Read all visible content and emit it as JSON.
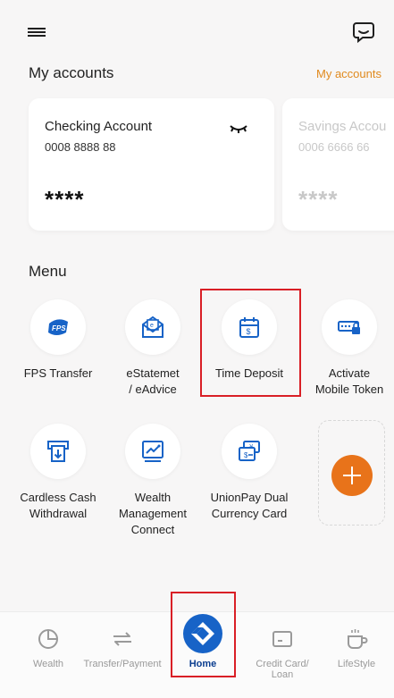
{
  "header": {
    "menu_icon": "hamburger-icon",
    "chat_icon": "chat-bubble-icon"
  },
  "accounts": {
    "title": "My accounts",
    "link": "My accounts",
    "cards": [
      {
        "name": "Checking Account",
        "number": "0008 8888 88",
        "balance": "****"
      },
      {
        "name": "Savings Accou",
        "number": "0006 6666 66",
        "balance": "****"
      }
    ]
  },
  "menu": {
    "title": "Menu",
    "items": [
      {
        "label": "FPS Transfer",
        "icon": "fps-icon"
      },
      {
        "label": "eStatemet\n/ eAdvice",
        "icon": "estatement-icon"
      },
      {
        "label": "Time Deposit",
        "icon": "time-deposit-icon"
      },
      {
        "label": "Activate\nMobile Token",
        "icon": "mobile-token-icon"
      },
      {
        "label": "Cardless Cash\nWithdrawal",
        "icon": "cardless-cash-icon"
      },
      {
        "label": "Wealth\nManagement\nConnect",
        "icon": "wealth-connect-icon"
      },
      {
        "label": "UnionPay Dual\nCurrency Card",
        "icon": "unionpay-card-icon"
      }
    ]
  },
  "bottom_nav": {
    "items": [
      {
        "label": "Wealth",
        "icon": "pie-chart-icon"
      },
      {
        "label": "Transfer/Payment",
        "icon": "transfer-arrows-icon"
      },
      {
        "label": "Home",
        "icon": "home-logo-icon"
      },
      {
        "label": "Credit Card/\nLoan",
        "icon": "credit-card-icon"
      },
      {
        "label": "LifeStyle",
        "icon": "coffee-cup-icon"
      }
    ]
  },
  "colors": {
    "accent_orange": "#e8731a",
    "link_orange": "#e08a1e",
    "highlight_red": "#d91f26",
    "home_blue": "#1763c7",
    "active_label": "#0a3d8f"
  }
}
